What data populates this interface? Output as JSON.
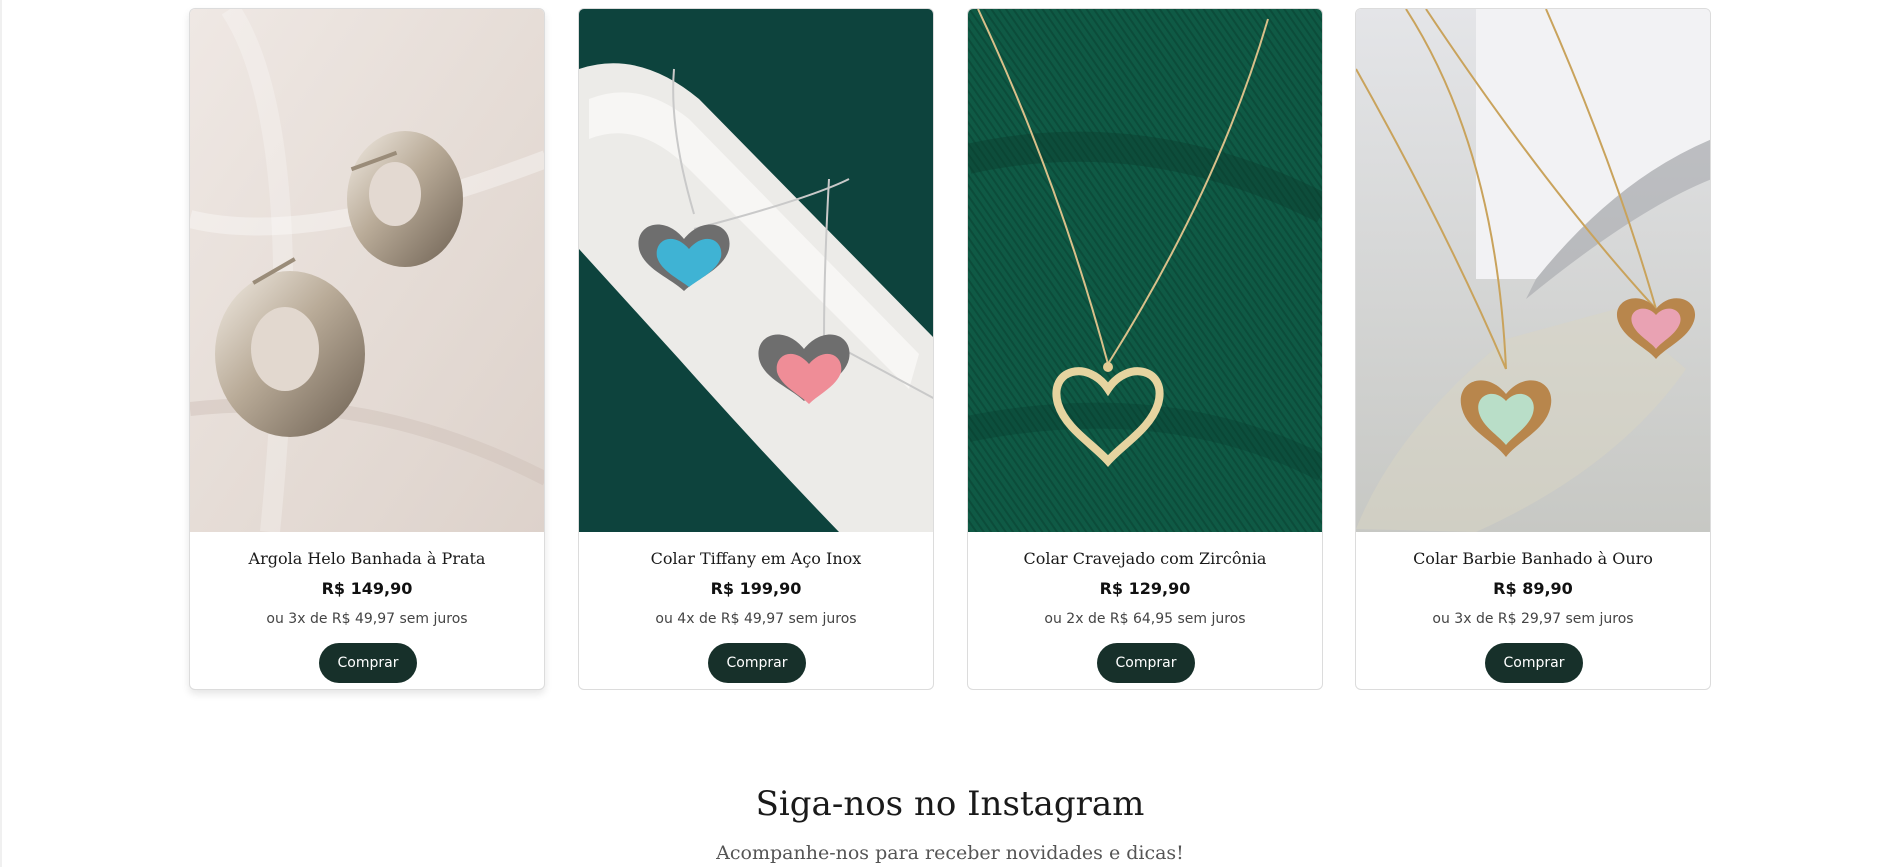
{
  "products": [
    {
      "name": "Argola Helo Banhada à Prata",
      "price": "R$ 149,90",
      "installments": "ou 3x de R$ 49,97 sem juros",
      "button": "Comprar"
    },
    {
      "name": "Colar Tiffany em Aço Inox",
      "price": "R$ 199,90",
      "installments": "ou 4x de R$ 49,97 sem juros",
      "button": "Comprar"
    },
    {
      "name": "Colar Cravejado com Zircônia",
      "price": "R$ 129,90",
      "installments": "ou 2x de R$ 64,95 sem juros",
      "button": "Comprar"
    },
    {
      "name": "Colar Barbie Banhado à Ouro",
      "price": "R$ 89,90",
      "installments": "ou 3x de R$ 29,97 sem juros",
      "button": "Comprar"
    }
  ],
  "instagram": {
    "title": "Siga-nos no Instagram",
    "subtitle": "Acompanhe-nos para receber novidades e dicas!"
  },
  "colors": {
    "button_bg": "#17302a",
    "button_text": "#ffffff",
    "card_border": "#dcdcdc"
  }
}
